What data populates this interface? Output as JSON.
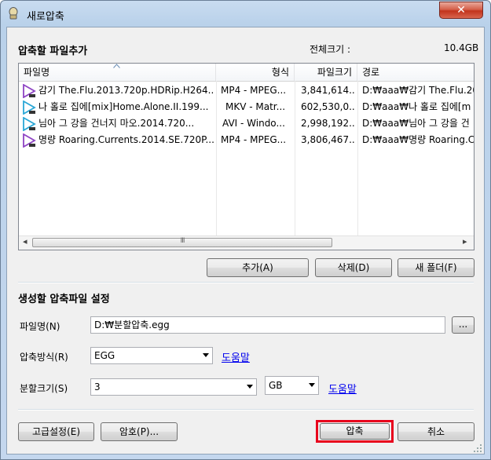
{
  "window": {
    "title": "새로압축",
    "close_label": "✕"
  },
  "add_files": {
    "section_title": "압축할 파일추가",
    "total_size_label": "전체크기 :",
    "total_size_value": "10.4GB",
    "columns": [
      "파일명",
      "형식",
      "파일크기",
      "경로"
    ],
    "rows": [
      {
        "name": "감기 The.Flu.2013.720p.HDRip.H264...",
        "format": "MP4 - MPEG...",
        "size": "3,841,614...",
        "path": "D:₩aaa₩감기 The.Flu.20"
      },
      {
        "name": "나 홀로 집에[mix]Home.Alone.II.199...",
        "format": "MKV - Matr...",
        "size": "602,530,0...",
        "path": "D:₩aaa₩나 홀로 집에[m"
      },
      {
        "name": "님아 그 강을 건너지 마오.2014.720...",
        "format": "AVI - Windo...",
        "size": "2,998,192...",
        "path": "D:₩aaa₩님아 그 강을 건"
      },
      {
        "name": "명량 Roaring.Currents.2014.SE.720P...",
        "format": "MP4 - MPEG...",
        "size": "3,806,467...",
        "path": "D:₩aaa₩명량 Roaring.C"
      }
    ],
    "scroll_left": "◂",
    "scroll_right": "▸",
    "scroll_grip": "III",
    "add_button": "추가(A)",
    "delete_button": "삭제(D)",
    "new_folder_button": "새 폴더(F)"
  },
  "settings": {
    "section_title": "생성할 압축파일 설정",
    "filename_label": "파일명(N)",
    "filename_value": "D:₩분할압축.egg",
    "browse_label": "...",
    "method_label": "압축방식(R)",
    "method_value": "EGG",
    "help_link": "도움말",
    "split_label": "분할크기(S)",
    "split_value": "3",
    "unit_value": "GB",
    "help_link2": "도움말"
  },
  "footer": {
    "advanced_button": "고급설정(E)",
    "password_button": "암호(P)...",
    "compress_button": "압축",
    "cancel_button": "취소"
  },
  "colors": {
    "highlight_border": "#e8001c",
    "link": "#0000ee",
    "file_icon": "#8e44c4"
  }
}
